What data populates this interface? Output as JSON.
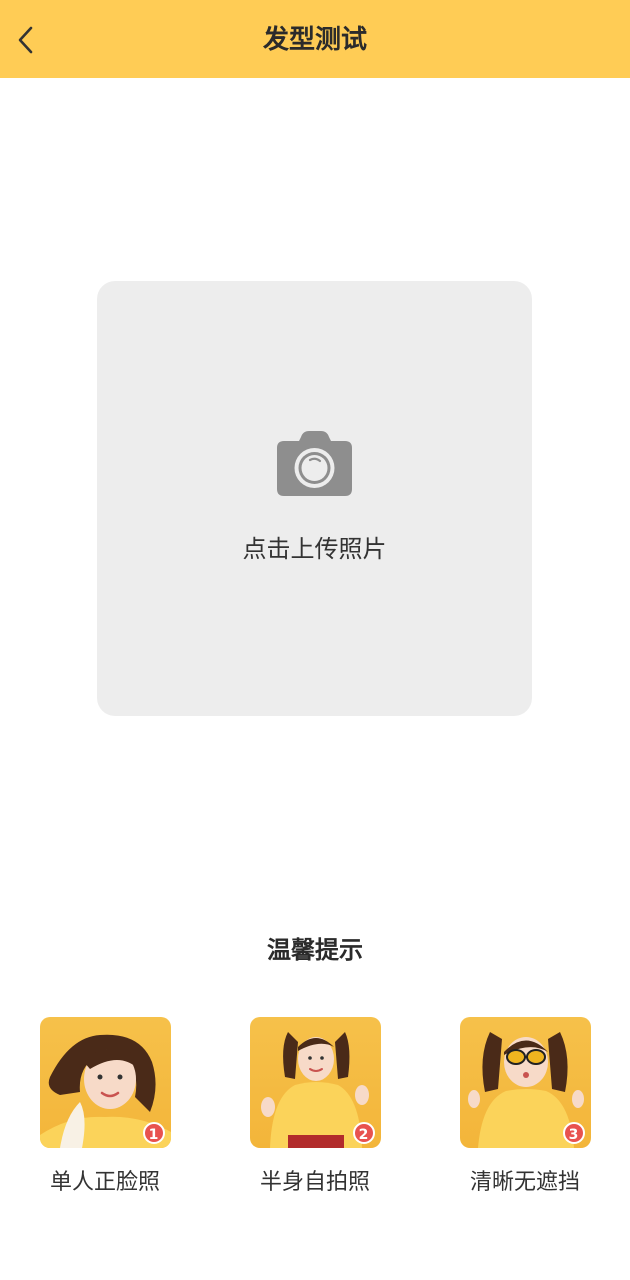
{
  "header": {
    "title": "发型测试",
    "back_icon": "chevron-left-icon",
    "bg_color": "#FFCC55"
  },
  "upload": {
    "label": "点击上传照片",
    "icon": "camera-icon"
  },
  "tips": {
    "title": "温馨提示",
    "items": [
      {
        "badge": "1",
        "caption": "单人正脸照"
      },
      {
        "badge": "2",
        "caption": "半身自拍照"
      },
      {
        "badge": "3",
        "caption": "清晰无遮挡"
      }
    ]
  }
}
